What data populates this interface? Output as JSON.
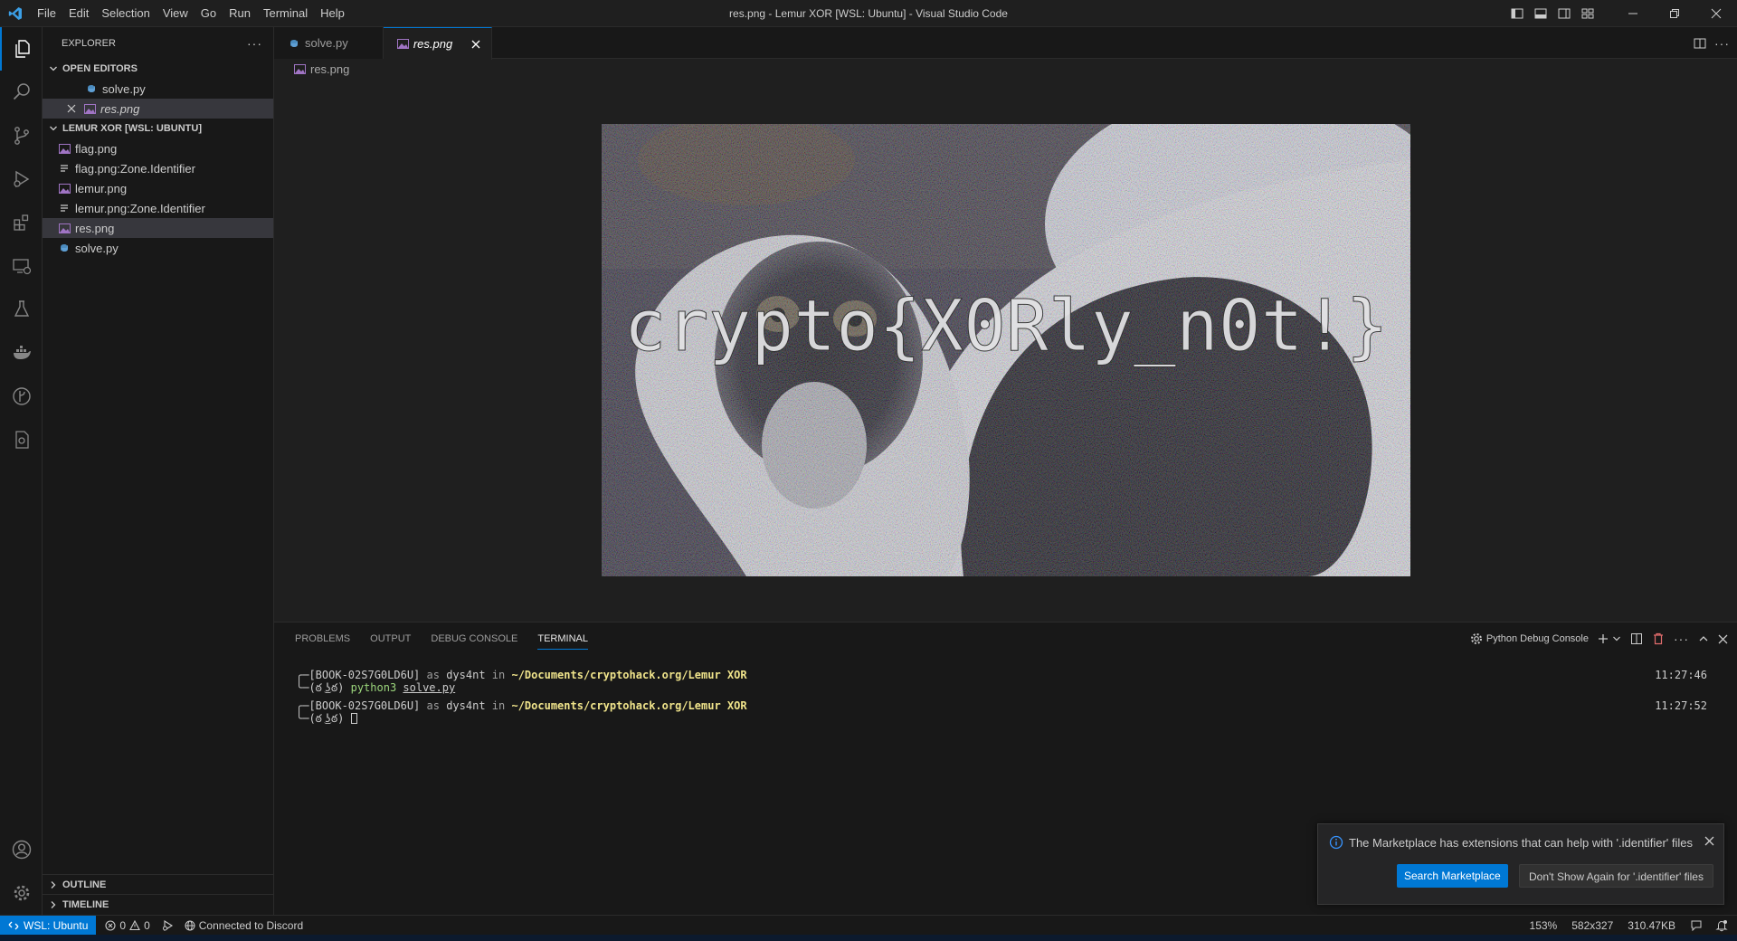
{
  "window": {
    "title": "res.png - Lemur XOR [WSL: Ubuntu] - Visual Studio Code",
    "menu": [
      "File",
      "Edit",
      "Selection",
      "View",
      "Go",
      "Run",
      "Terminal",
      "Help"
    ]
  },
  "sidebar": {
    "header": "EXPLORER",
    "open_editors_label": "OPEN EDITORS",
    "open_editors": [
      {
        "name": "solve.py",
        "icon": "python-file-icon"
      },
      {
        "name": "res.png",
        "icon": "image-file-icon"
      }
    ],
    "workspace_label": "LEMUR XOR [WSL: UBUNTU]",
    "files": [
      {
        "name": "flag.png",
        "icon": "image-file-icon"
      },
      {
        "name": "flag.png:Zone.Identifier",
        "icon": "text-file-icon"
      },
      {
        "name": "lemur.png",
        "icon": "image-file-icon"
      },
      {
        "name": "lemur.png:Zone.Identifier",
        "icon": "text-file-icon"
      },
      {
        "name": "res.png",
        "icon": "image-file-icon"
      },
      {
        "name": "solve.py",
        "icon": "python-file-icon"
      }
    ],
    "outline_label": "OUTLINE",
    "timeline_label": "TIMELINE"
  },
  "tabs": [
    {
      "label": "solve.py",
      "active": false
    },
    {
      "label": "res.png",
      "active": true
    }
  ],
  "breadcrumb": "res.png",
  "image": {
    "overlay_text": "crypto{X0Rly_n0t!}"
  },
  "panel": {
    "tabs": [
      "PROBLEMS",
      "OUTPUT",
      "DEBUG CONSOLE",
      "TERMINAL"
    ],
    "active_tab": "TERMINAL",
    "terminal_profile": "Python Debug Console"
  },
  "terminal": {
    "host": "[BOOK-02S7G0LD6U]",
    "as": "as",
    "user": "dys4nt",
    "in": "in",
    "path": "~/Documents/cryptohack.org/Lemur XOR",
    "face": "(ఠ ͜ʖఠ)",
    "command_prog": "python3",
    "command_arg": "solve.py",
    "time1": "11:27:46",
    "time2": "11:27:52"
  },
  "notification": {
    "message": "The Marketplace has extensions that can help with '.identifier' files",
    "primary_button": "Search Marketplace",
    "secondary_button": "Don't Show Again for '.identifier' files"
  },
  "statusbar": {
    "remote": "WSL: Ubuntu",
    "errors": "0",
    "warnings": "0",
    "discord": "Connected to Discord",
    "zoom": "153%",
    "dimensions": "582x327",
    "filesize": "310.47KB"
  },
  "colors": {
    "accent": "#0078d4",
    "background": "#1f1f1f",
    "sidebar": "#181818",
    "terminal_yellow": "#f0e48b",
    "terminal_green": "#9cd67c"
  }
}
